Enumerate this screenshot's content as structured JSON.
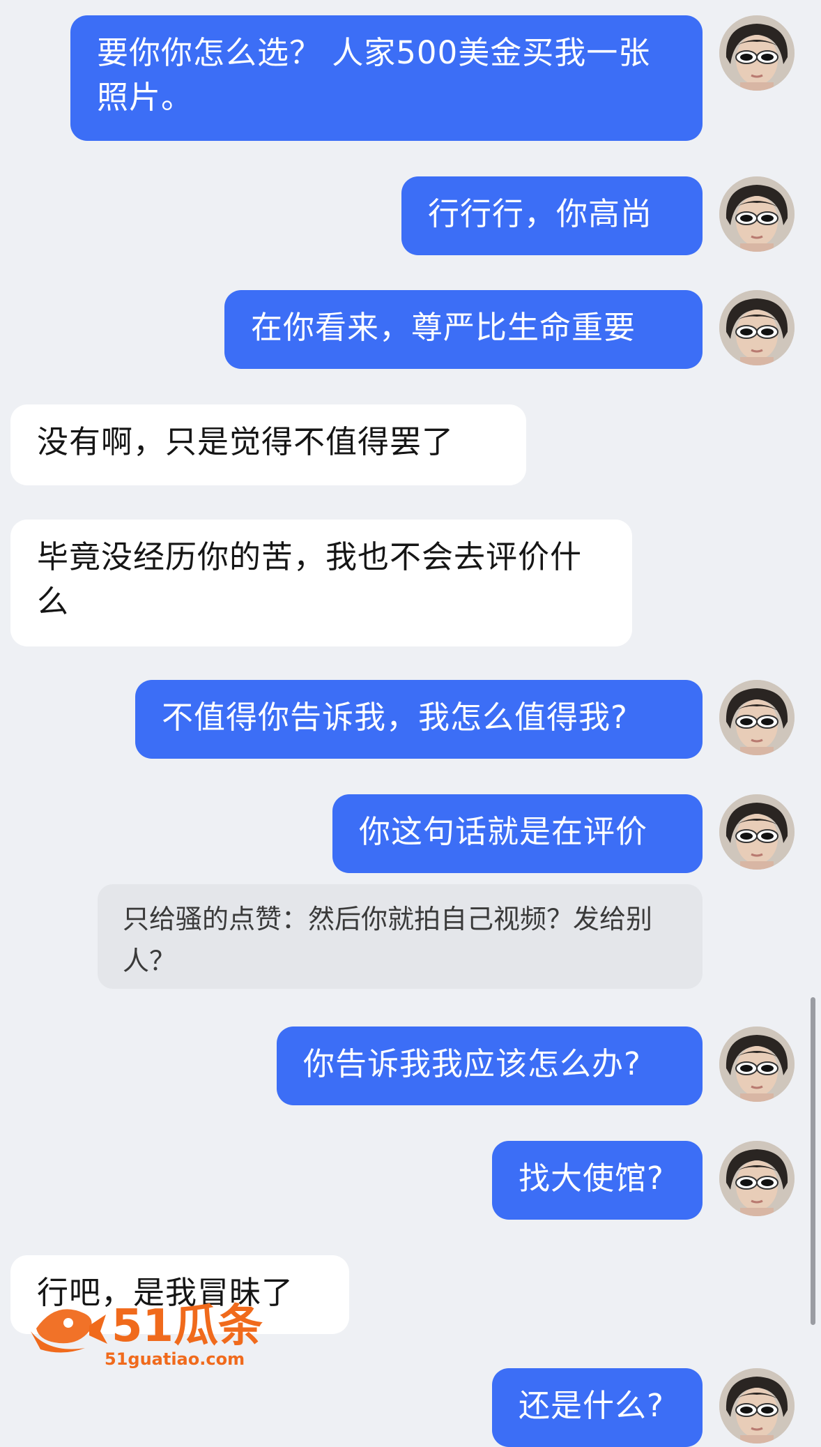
{
  "messages": [
    {
      "side": "mine",
      "text": "要你你怎么选？ 人家500美金买我一张照片。"
    },
    {
      "side": "mine",
      "text": "行行行，你高尚"
    },
    {
      "side": "mine",
      "text": "在你看来，尊严比生命重要"
    },
    {
      "side": "theirs",
      "text": "没有啊，只是觉得不值得罢了"
    },
    {
      "side": "theirs",
      "text": "毕竟没经历你的苦，我也不会去评价什么"
    },
    {
      "side": "mine",
      "text": "不值得你告诉我，我怎么值得我?"
    },
    {
      "side": "mine",
      "text": "你这句话就是在评价"
    },
    {
      "side": "quote",
      "text": "只给骚的点赞：然后你就拍自己视频？发给别人？"
    },
    {
      "side": "mine",
      "text": "你告诉我我应该怎么办?"
    },
    {
      "side": "mine",
      "text": "找大使馆?"
    },
    {
      "side": "theirs",
      "text": "行吧，是我冒昧了"
    },
    {
      "side": "mine",
      "text": "还是什么?"
    }
  ],
  "watermark": {
    "brand": "51瓜条",
    "url": "51guatiao.com"
  },
  "colors": {
    "mine_bubble": "#3c6ef6",
    "theirs_bubble": "#ffffff",
    "background": "#eef0f4",
    "watermark": "#f06a1c"
  },
  "avatar_icon": "user-avatar-sunglasses-icon"
}
